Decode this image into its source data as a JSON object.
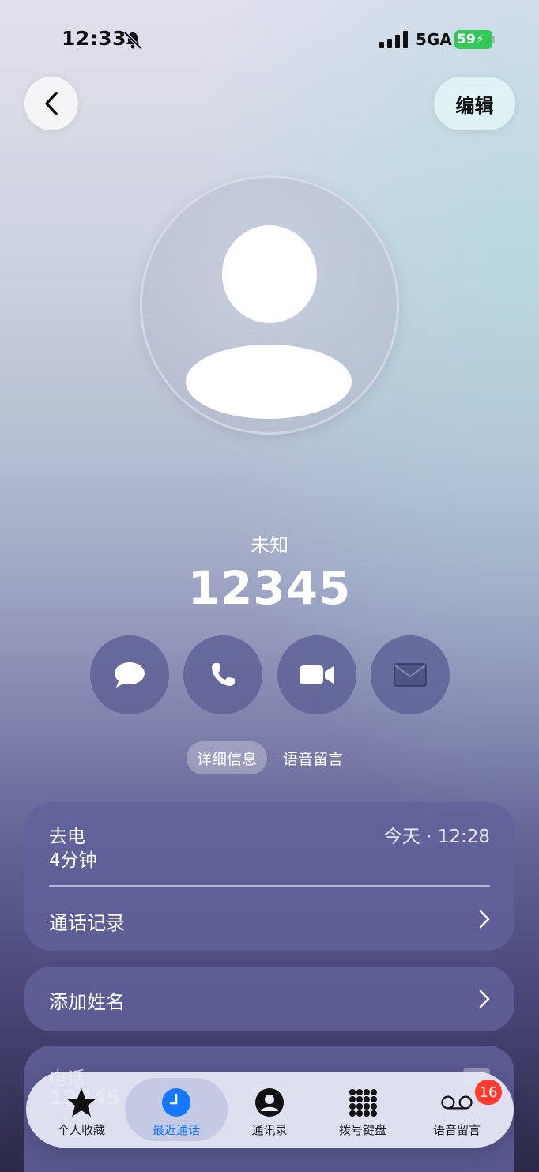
{
  "status_bar": {
    "time": "12:33",
    "network": "5GA",
    "battery": "59"
  },
  "header": {
    "edit_label": "编辑"
  },
  "contact": {
    "label": "未知",
    "number": "12345"
  },
  "actions": [
    "message-icon",
    "phone-icon",
    "video-icon",
    "mail-icon"
  ],
  "segments": {
    "details": "详细信息",
    "voicemail": "语音留言"
  },
  "recent_call": {
    "direction": "去电",
    "duration": "4分钟",
    "time": "今天 · 12:28"
  },
  "call_history_label": "通话记录",
  "add_name_label": "添加姓名",
  "phone_card": {
    "label": "电话",
    "value": "12345"
  },
  "tabbar": {
    "items": [
      {
        "label": "个人收藏",
        "icon": "star-icon"
      },
      {
        "label": "最近通话",
        "icon": "clock-icon"
      },
      {
        "label": "通讯录",
        "icon": "person-icon"
      },
      {
        "label": "拨号键盘",
        "icon": "keypad-icon"
      },
      {
        "label": "语音留言",
        "icon": "voicemail-icon"
      }
    ],
    "voicemail_badge": "16"
  },
  "colors": {
    "accent": "#1677ff",
    "battery": "#34c759",
    "badge": "#ff3b30"
  }
}
